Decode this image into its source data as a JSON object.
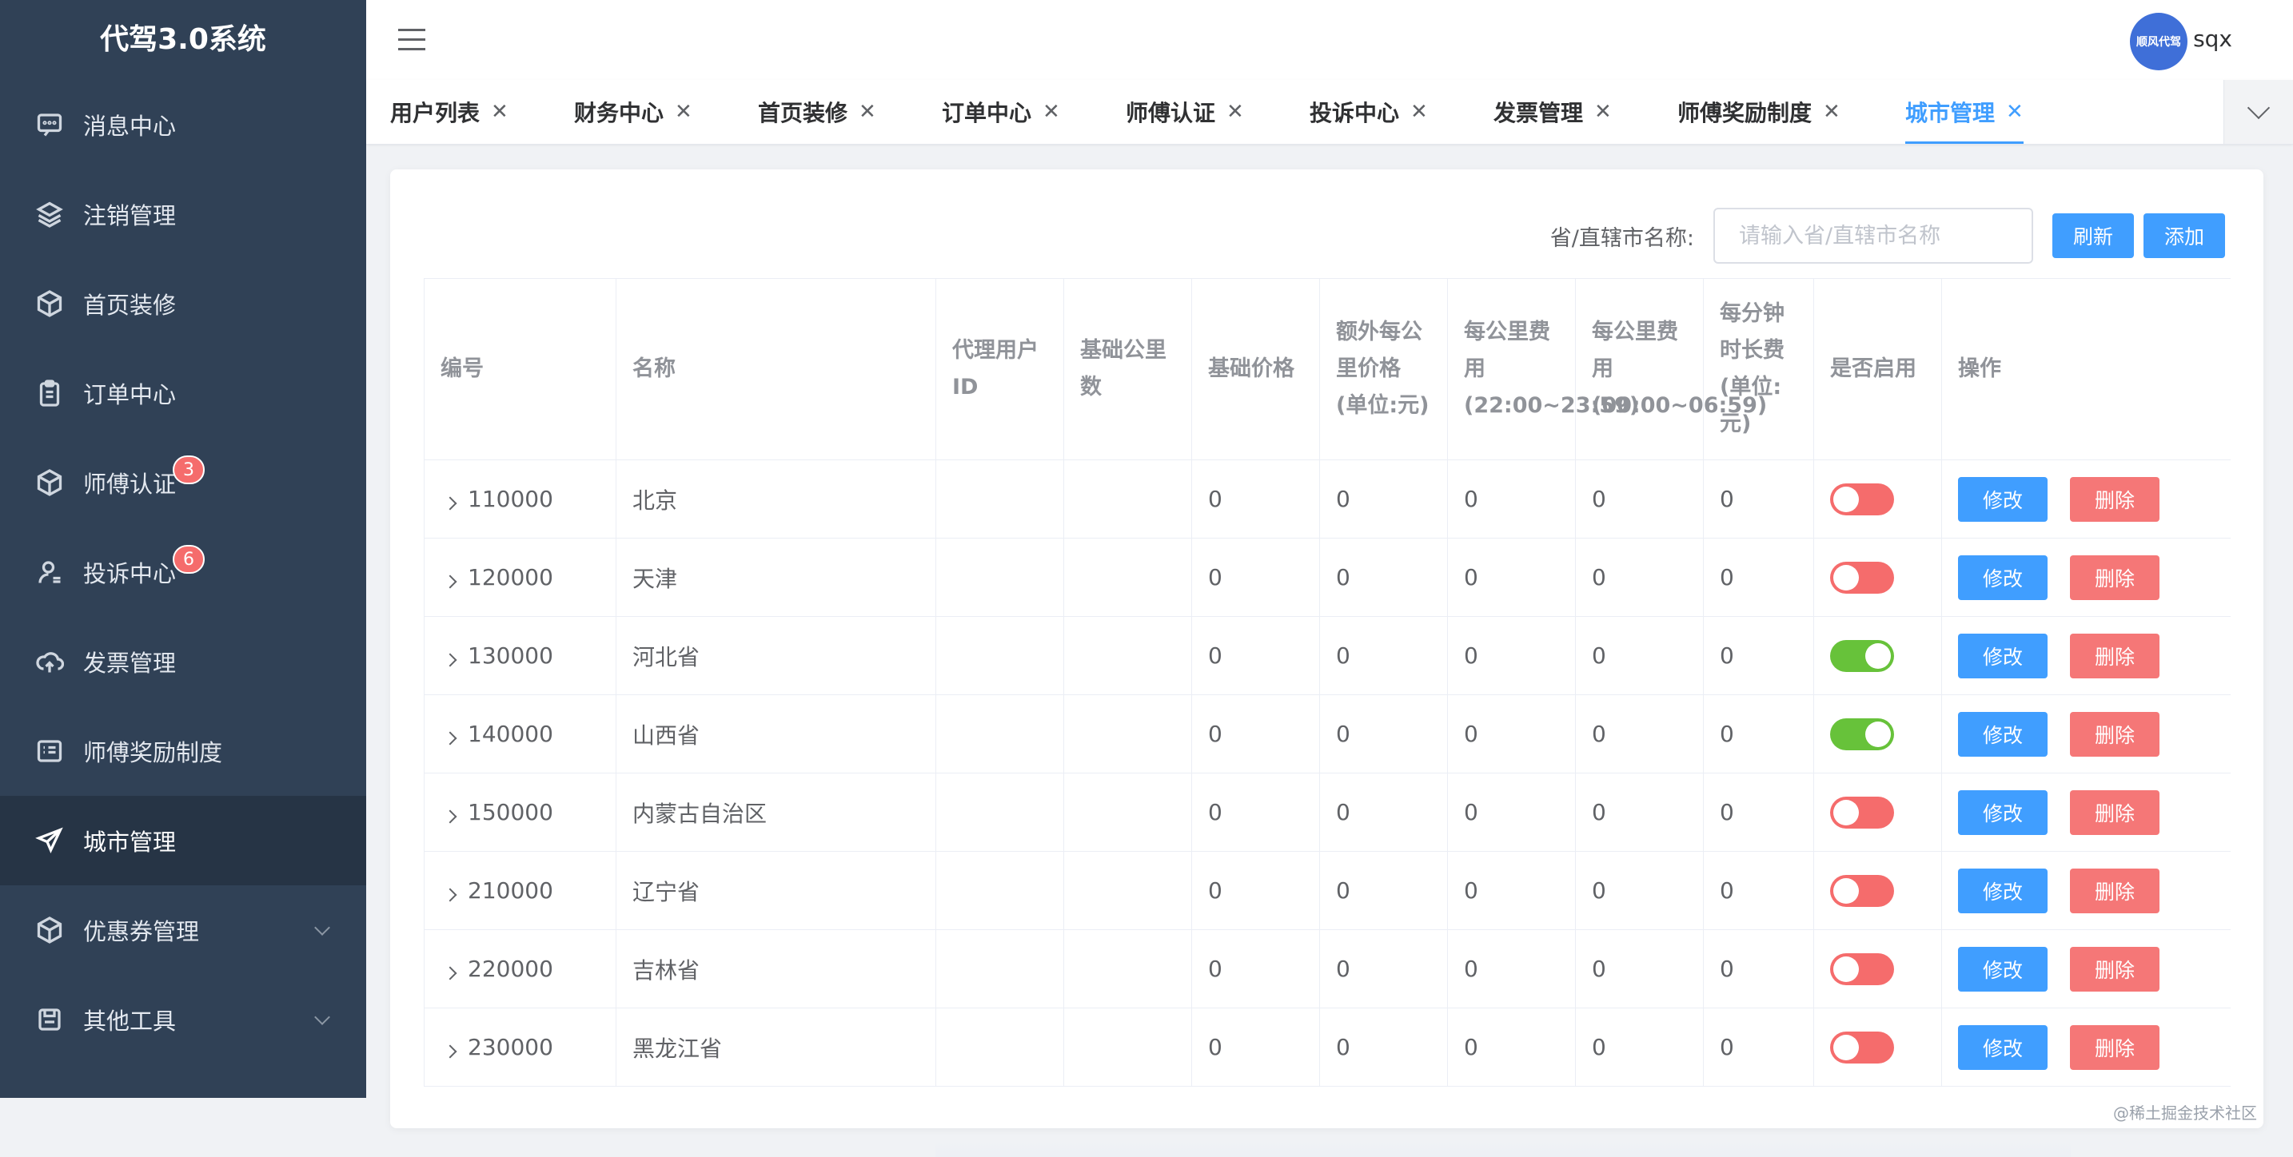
{
  "app": {
    "title": "代驾3.0系统"
  },
  "sidebar": {
    "items": [
      {
        "label": "消息中心",
        "icon": "message-icon"
      },
      {
        "label": "注销管理",
        "icon": "layers-icon"
      },
      {
        "label": "首页装修",
        "icon": "box-icon"
      },
      {
        "label": "订单中心",
        "icon": "clipboard-icon"
      },
      {
        "label": "师傅认证",
        "icon": "box-icon",
        "badge": "3"
      },
      {
        "label": "投诉中心",
        "icon": "user-icon",
        "badge": "6"
      },
      {
        "label": "发票管理",
        "icon": "cloud-upload-icon"
      },
      {
        "label": "师傅奖励制度",
        "icon": "list-card-icon"
      },
      {
        "label": "城市管理",
        "icon": "send-icon",
        "active": true
      },
      {
        "label": "优惠券管理",
        "icon": "box-icon",
        "expandable": true
      },
      {
        "label": "其他工具",
        "icon": "save-icon",
        "expandable": true
      }
    ]
  },
  "header": {
    "avatar_text": "顺风代驾",
    "username": "sqx"
  },
  "tabs": [
    {
      "label": "用户列表"
    },
    {
      "label": "财务中心"
    },
    {
      "label": "首页装修"
    },
    {
      "label": "订单中心"
    },
    {
      "label": "师傅认证"
    },
    {
      "label": "投诉中心"
    },
    {
      "label": "发票管理"
    },
    {
      "label": "师傅奖励制度"
    },
    {
      "label": "城市管理",
      "active": true
    }
  ],
  "search": {
    "label": "省/直辖市名称:",
    "placeholder": "请输入省/直辖市名称",
    "value": "",
    "refresh_label": "刷新",
    "add_label": "添加"
  },
  "table": {
    "columns": [
      "编号",
      "名称",
      "代理用户ID",
      "基础公里数",
      "基础价格",
      "额外每公里价格(单位:元)",
      "每公里费用(22:00~23:59)",
      "每公里费用(00:00~06:59)",
      "每分钟时长费(单位:元)",
      "是否启用",
      "操作"
    ],
    "edit_label": "修改",
    "delete_label": "删除",
    "rows": [
      {
        "id": "110000",
        "name": "北京",
        "agent_user_id": "",
        "base_km": "",
        "base_price": "0",
        "extra_km_price": "0",
        "night_km_fee": "0",
        "early_km_fee": "0",
        "minute_fee": "0",
        "enabled": false
      },
      {
        "id": "120000",
        "name": "天津",
        "agent_user_id": "",
        "base_km": "",
        "base_price": "0",
        "extra_km_price": "0",
        "night_km_fee": "0",
        "early_km_fee": "0",
        "minute_fee": "0",
        "enabled": false
      },
      {
        "id": "130000",
        "name": "河北省",
        "agent_user_id": "",
        "base_km": "",
        "base_price": "0",
        "extra_km_price": "0",
        "night_km_fee": "0",
        "early_km_fee": "0",
        "minute_fee": "0",
        "enabled": true
      },
      {
        "id": "140000",
        "name": "山西省",
        "agent_user_id": "",
        "base_km": "",
        "base_price": "0",
        "extra_km_price": "0",
        "night_km_fee": "0",
        "early_km_fee": "0",
        "minute_fee": "0",
        "enabled": true
      },
      {
        "id": "150000",
        "name": "内蒙古自治区",
        "agent_user_id": "",
        "base_km": "",
        "base_price": "0",
        "extra_km_price": "0",
        "night_km_fee": "0",
        "early_km_fee": "0",
        "minute_fee": "0",
        "enabled": false
      },
      {
        "id": "210000",
        "name": "辽宁省",
        "agent_user_id": "",
        "base_km": "",
        "base_price": "0",
        "extra_km_price": "0",
        "night_km_fee": "0",
        "early_km_fee": "0",
        "minute_fee": "0",
        "enabled": false
      },
      {
        "id": "220000",
        "name": "吉林省",
        "agent_user_id": "",
        "base_km": "",
        "base_price": "0",
        "extra_km_price": "0",
        "night_km_fee": "0",
        "early_km_fee": "0",
        "minute_fee": "0",
        "enabled": false
      },
      {
        "id": "230000",
        "name": "黑龙江省",
        "agent_user_id": "",
        "base_km": "",
        "base_price": "0",
        "extra_km_price": "0",
        "night_km_fee": "0",
        "early_km_fee": "0",
        "minute_fee": "0",
        "enabled": false
      }
    ]
  },
  "colors": {
    "sidebar_bg": "#304156",
    "primary": "#409eff",
    "danger": "#f56c6c",
    "success": "#67c23a"
  },
  "watermark": "@稀土掘金技术社区"
}
